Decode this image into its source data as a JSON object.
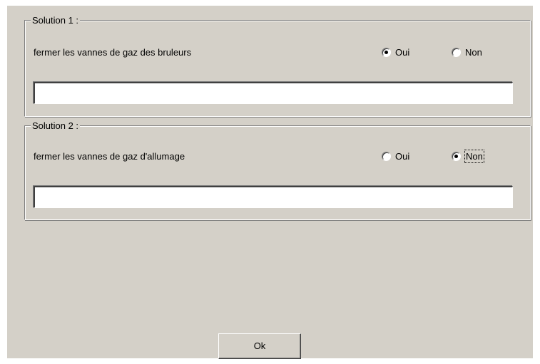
{
  "dialog": {
    "groups": [
      {
        "legend": "Solution 1 :",
        "question": "fermer les vannes de gaz des bruleurs",
        "options": [
          {
            "label": "Oui",
            "checked": true
          },
          {
            "label": "Non",
            "checked": false
          }
        ],
        "text_value": ""
      },
      {
        "legend": "Solution 2 :",
        "question": "fermer les vannes de gaz d'allumage",
        "options": [
          {
            "label": "Oui",
            "checked": false
          },
          {
            "label": "Non",
            "checked": true,
            "focused": true
          }
        ],
        "text_value": ""
      }
    ],
    "ok_label": "Ok"
  }
}
